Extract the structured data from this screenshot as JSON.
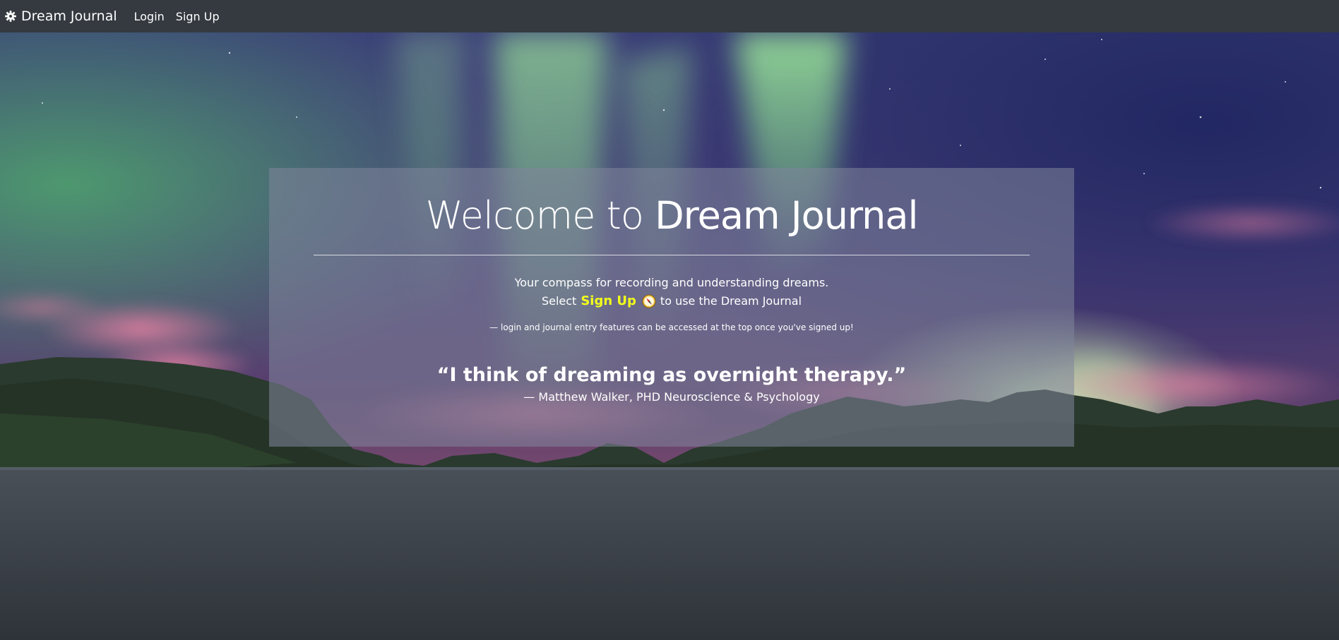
{
  "navbar": {
    "brand": "Dream Journal",
    "brand_icon": "gear-icon",
    "links": [
      {
        "label": "Login"
      },
      {
        "label": "Sign Up"
      }
    ]
  },
  "hero": {
    "title_prefix": "Welcome to ",
    "title_emphasis": "Dream Journal",
    "tagline": "Your compass for recording and understanding dreams.",
    "select_prefix": "Select",
    "select_highlight": "Sign Up",
    "select_icon": "compass-icon",
    "select_suffix": "to use the Dream Journal",
    "note": "— login and journal entry features can be accessed at the top once you've signed up!",
    "quote": "“I think of dreaming as overnight therapy.”",
    "attribution": "— Matthew Walker, PHD Neuroscience & Psychology"
  },
  "colors": {
    "navbar_bg": "#343a40",
    "highlight": "#f2ff1a",
    "card_overlay": "rgba(128,133,155,0.55)"
  }
}
